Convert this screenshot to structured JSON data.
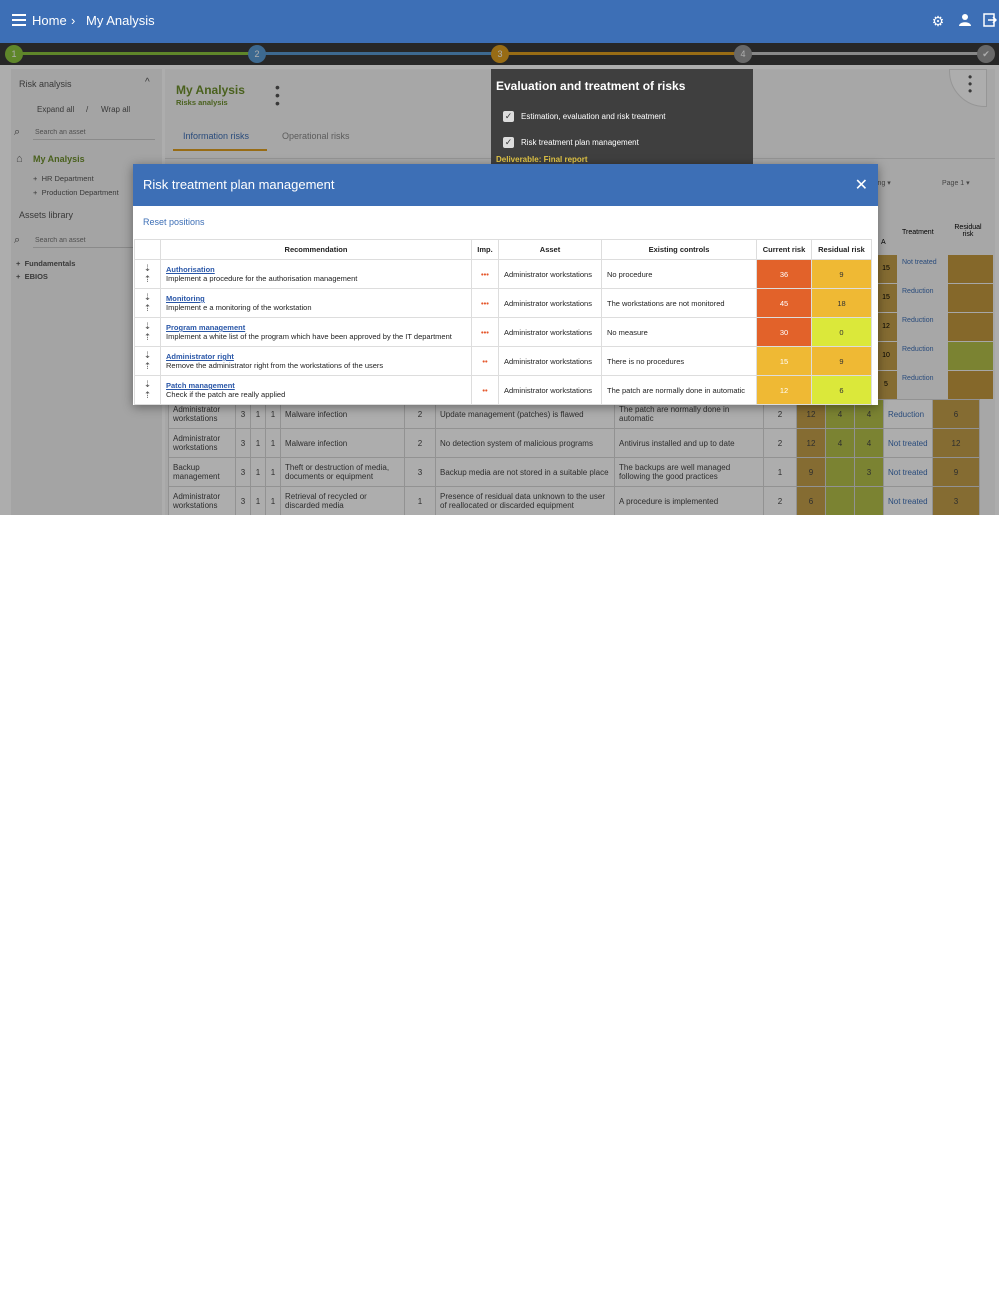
{
  "header": {
    "crumb_home": "Home",
    "crumb_sep": "›",
    "crumb_current": "My Analysis",
    "icons": [
      "gear-icon",
      "user-icon",
      "logout-icon"
    ]
  },
  "stepper": {
    "steps": [
      {
        "label": "1",
        "color": "#8cc63f"
      },
      {
        "label": "2",
        "color": "#5b9bd5"
      },
      {
        "label": "3",
        "color": "#e0a020"
      },
      {
        "label": "4",
        "color": "#9a9a9a"
      },
      {
        "label": "✔",
        "color": "#9a9a9a"
      }
    ]
  },
  "sidebar": {
    "risk_analysis": "Risk analysis",
    "expand_all": "Expand all",
    "wrap_all": "Wrap all",
    "search_placeholder": "Search an asset",
    "my_analysis": "My Analysis",
    "hr": "HR Department",
    "prod": "Production Department",
    "assets_library": "Assets library",
    "fundamentals": "Fundamentals",
    "ebios": "EBIOS"
  },
  "main": {
    "title": "My Analysis",
    "subtitle": "Risks analysis",
    "tab_info": "Information risks",
    "tab_op": "Operational risks",
    "sort_fragment": "ing",
    "page_label": "Page 1",
    "col_a": "A",
    "col_treatment": "Treatment",
    "col_residual": "Residual risk",
    "right_rows": [
      {
        "v": "15",
        "t": "Not treated",
        "r": "18"
      },
      {
        "v": "15",
        "t": "Reduction",
        "r": "18"
      },
      {
        "v": "12",
        "t": "Reduction",
        "r": "9"
      },
      {
        "v": "10",
        "t": "Reduction",
        "r": "0"
      },
      {
        "v": "5",
        "t": "Reduction",
        "r": "9"
      }
    ],
    "rows": [
      {
        "asset": "Administrator workstations",
        "c": "3",
        "i": "1",
        "a": "1",
        "threat": "Malware infection",
        "p": "2",
        "vuln": "Update management (patches) is flawed",
        "ctrl": "The patch are normally done in automatic",
        "n": "2",
        "r1": "12",
        "r2": "4",
        "r3": "4",
        "treat": "Reduction",
        "res": "6"
      },
      {
        "asset": "Administrator workstations",
        "c": "3",
        "i": "1",
        "a": "1",
        "threat": "Malware infection",
        "p": "2",
        "vuln": "No detection system of malicious programs",
        "ctrl": "Antivirus installed and up to date",
        "n": "2",
        "r1": "12",
        "r2": "4",
        "r3": "4",
        "treat": "Not treated",
        "res": "12"
      },
      {
        "asset": "Backup management",
        "c": "3",
        "i": "1",
        "a": "1",
        "threat": "Theft or destruction of media, documents or equipment",
        "p": "3",
        "vuln": "Backup media are not stored in a suitable place",
        "ctrl": "The backups are well managed following the good practices",
        "n": "1",
        "r1": "9",
        "r2": "",
        "r3": "3",
        "treat": "Not treated",
        "res": "9"
      },
      {
        "asset": "Administrator workstations",
        "c": "3",
        "i": "1",
        "a": "1",
        "threat": "Retrieval of recycled or discarded media",
        "p": "1",
        "vuln": "Presence of residual data unknown to the user of reallocated or discarded equipment",
        "ctrl": "A procedure is implemented",
        "n": "2",
        "r1": "6",
        "r2": "",
        "r3": "",
        "treat": "Not treated",
        "res": "3"
      }
    ]
  },
  "popover": {
    "title": "Evaluation and treatment of risks",
    "item1": "Estimation, evaluation and risk treatment",
    "item2": "Risk treatment plan management",
    "deliverable": "Deliverable: Final report"
  },
  "modal": {
    "title": "Risk treatment plan management",
    "close": "✕",
    "reset": "Reset positions",
    "headers": [
      "Recommendation",
      "Imp.",
      "Asset",
      "Existing controls",
      "Current risk",
      "Residual risk"
    ],
    "rows": [
      {
        "name": "Authorisation",
        "desc": "Implement a procedure for the authorisation management",
        "imp": "•••",
        "asset": "Administrator workstations",
        "control": "No procedure",
        "current": "36",
        "current_color": "#e2622a",
        "residual": "9",
        "residual_color": "#efb934"
      },
      {
        "name": "Monitoring",
        "desc": "Implement e a monitoring of the workstation",
        "imp": "•••",
        "asset": "Administrator workstations",
        "control": "The workstations are not monitored",
        "current": "45",
        "current_color": "#e2622a",
        "residual": "18",
        "residual_color": "#efb934"
      },
      {
        "name": "Program management",
        "desc": "Implement a white list of the program which have been approved by the IT department",
        "imp": "•••",
        "asset": "Administrator workstations",
        "control": "No measure",
        "current": "30",
        "current_color": "#e2622a",
        "residual": "0",
        "residual_color": "#dbe83a"
      },
      {
        "name": "Administrator right",
        "desc": "Remove the administrator right from the workstations of the users",
        "imp": "••",
        "asset": "Administrator workstations",
        "control": "There is no procedures",
        "current": "15",
        "current_color": "#efb934",
        "residual": "9",
        "residual_color": "#efb934"
      },
      {
        "name": "Patch management",
        "desc": "Check if the patch are really applied",
        "imp": "••",
        "asset": "Administrator workstations",
        "control": "The patch are normally done in automatic",
        "current": "12",
        "current_color": "#efb934",
        "residual": "6",
        "residual_color": "#dbe83a"
      }
    ]
  }
}
